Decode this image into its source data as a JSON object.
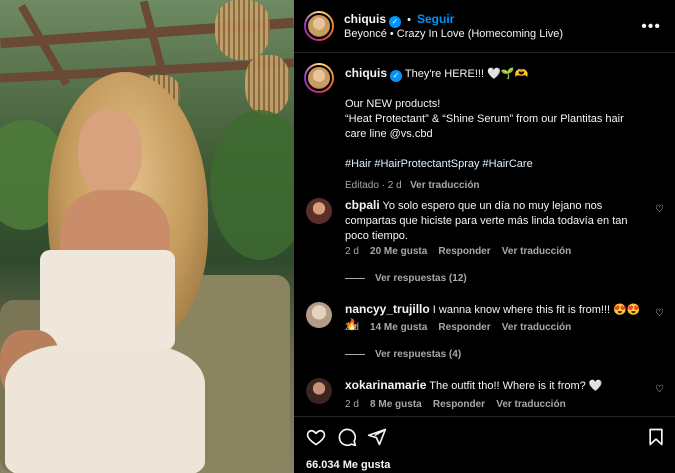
{
  "header": {
    "username": "chiquis",
    "separator": "•",
    "follow_label": "Seguir",
    "audio": "Beyoncé • Crazy In Love (Homecoming Live)",
    "more_icon": "more-options-icon"
  },
  "caption": {
    "username": "chiquis",
    "line1": "They're HERE!!! 🤍🌱🫶",
    "line2": "Our NEW products!",
    "line3": "“Heat Protectant” & “Shine Serum” from our Plantitas hair care line @vs.cbd",
    "hashtags": "#Hair #HairProtectantSpray #HairCare",
    "edited": "Editado · 2 d",
    "translate": "Ver traducción"
  },
  "comments": [
    {
      "username": "cbpali",
      "text": "Yo solo espero que un día no muy lejano nos compartas que hiciste para verte más linda todavía en tan poco tiempo.",
      "age": "2 d",
      "likes": "20 Me gusta",
      "reply": "Responder",
      "translate": "Ver traducción",
      "replies": "Ver respuestas (12)"
    },
    {
      "username": "nancyy_trujillo",
      "text": "I wanna know where this fit is from!!! 😍😍🔥",
      "age": "2 d",
      "likes": "14 Me gusta",
      "reply": "Responder",
      "translate": "Ver traducción",
      "replies": "Ver respuestas (4)"
    },
    {
      "username": "xokarinamarie",
      "text": "The outfit tho!! Where is it from? 🤍",
      "age": "2 d",
      "likes": "8 Me gusta",
      "reply": "Responder",
      "translate": "Ver traducción"
    }
  ],
  "footer": {
    "likes": "66.034 Me gusta",
    "icons": [
      "like-icon",
      "comment-icon",
      "share-icon",
      "save-icon"
    ]
  },
  "colors": {
    "accent": "#0095f6",
    "background": "#000000",
    "muted": "#a8a8a8"
  }
}
